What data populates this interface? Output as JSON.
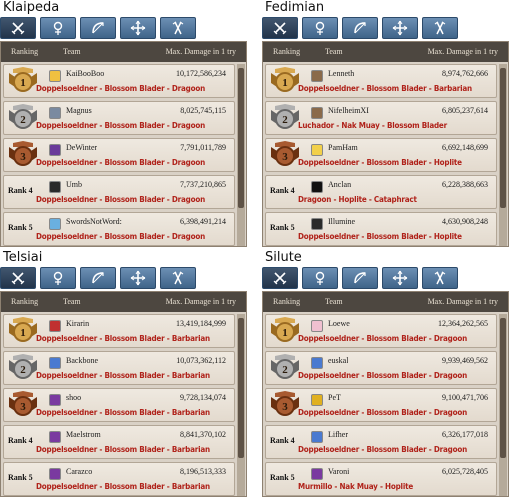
{
  "header": {
    "ranking": "Ranking",
    "team": "Team",
    "damage": "Max. Damage in 1 try"
  },
  "tabs": [
    "swords-icon",
    "spirit-icon",
    "bow-icon",
    "cross-icon",
    "scout-icon"
  ],
  "colors": {
    "accent_tab": "#4a6a8e",
    "build_text": "#b0221a",
    "gold": "#c8963c",
    "silver": "#8c8c8c",
    "bronze": "#8a4a2a"
  },
  "servers": [
    {
      "name": "Klaipeda",
      "rows": [
        {
          "rank": "1",
          "team": "KaiBooBoo",
          "damage": "10,172,586,234",
          "build": "Doppelsoeldner - Blossom Blader - Dragoon",
          "avatar": "sunglasses-icon"
        },
        {
          "rank": "2",
          "team": "Magnus",
          "damage": "8,025,745,115",
          "build": "Doppelsoeldner - Blossom Blader - Dragoon",
          "avatar": "helmet-icon"
        },
        {
          "rank": "3",
          "team": "DeWinter",
          "damage": "7,791,011,789",
          "build": "Doppelsoeldner - Blossom Blader - Dragoon",
          "avatar": "purple-crest-icon"
        },
        {
          "rank": "Rank 4",
          "team": "Umb",
          "damage": "7,737,210,865",
          "build": "Doppelsoeldner - Blossom Blader - Dragoon",
          "avatar": "dark-icon"
        },
        {
          "rank": "Rank 5",
          "team": "SwordsNotWord:",
          "damage": "6,398,491,214",
          "build": "Doppelsoeldner - Blossom Blader - Dragoon",
          "avatar": "blue-icon"
        }
      ]
    },
    {
      "name": "Fedimian",
      "rows": [
        {
          "rank": "1",
          "team": "Lenneth",
          "damage": "8,974,762,666",
          "build": "Doppelsoeldner - Blossom Blader - Barbarian",
          "avatar": "portrait-icon"
        },
        {
          "rank": "2",
          "team": "NifelheimXI",
          "damage": "6,805,237,614",
          "build": "Luchador - Nak Muay - Blossom Blader",
          "avatar": "portrait-icon"
        },
        {
          "rank": "3",
          "team": "PamHam",
          "damage": "6,692,148,699",
          "build": "Doppelsoeldner - Blossom Blader - Hoplite",
          "avatar": "chick-icon"
        },
        {
          "rank": "Rank 4",
          "team": "Anclan",
          "damage": "6,228,388,663",
          "build": "Dragoon - Hoplite - Cataphract",
          "avatar": "moon-icon"
        },
        {
          "rank": "Rank 5",
          "team": "Illumine",
          "damage": "4,630,908,248",
          "build": "Doppelsoeldner - Blossom Blader - Hoplite",
          "avatar": "dark-icon"
        }
      ]
    },
    {
      "name": "Telsiai",
      "rows": [
        {
          "rank": "1",
          "team": "Kirarin",
          "damage": "13,419,184,999",
          "build": "Doppelsoeldner - Blossom Blader - Barbarian",
          "avatar": "red-creature-icon"
        },
        {
          "rank": "2",
          "team": "Backbone",
          "damage": "10,073,362,112",
          "build": "Doppelsoeldner - Blossom Blader - Barbarian",
          "avatar": "blue-creature-icon"
        },
        {
          "rank": "3",
          "team": "shoo",
          "damage": "9,728,134,074",
          "build": "Doppelsoeldner - Blossom Blader - Barbarian",
          "avatar": "purple-creature-icon"
        },
        {
          "rank": "Rank 4",
          "team": "Maelstrom",
          "damage": "8,841,370,102",
          "build": "Doppelsoeldner - Blossom Blader - Barbarian",
          "avatar": "purple-creature-icon"
        },
        {
          "rank": "Rank 5",
          "team": "Carazco",
          "damage": "8,196,513,333",
          "build": "Doppelsoeldner - Blossom Blader - Barbarian",
          "avatar": "purple-creature-icon"
        }
      ]
    },
    {
      "name": "Silute",
      "rows": [
        {
          "rank": "1",
          "team": "Loewe",
          "damage": "12,364,262,565",
          "build": "Doppelsoeldner - Blossom Blader - Dragoon",
          "avatar": "pink-icon"
        },
        {
          "rank": "2",
          "team": "euskal",
          "damage": "9,939,469,562",
          "build": "Doppelsoeldner - Blossom Blader - Dragoon",
          "avatar": "blue-creature-icon"
        },
        {
          "rank": "3",
          "team": "PeT",
          "damage": "9,100,471,706",
          "build": "Doppelsoeldner - Blossom Blader - Dragoon",
          "avatar": "yellow-p-icon"
        },
        {
          "rank": "Rank 4",
          "team": "Lifher",
          "damage": "6,326,177,018",
          "build": "Doppelsoeldner - Blossom Blader - Dragoon",
          "avatar": "blue-creature-icon"
        },
        {
          "rank": "Rank 5",
          "team": "Varoni",
          "damage": "6,025,728,405",
          "build": "Murmillo - Nak Muay - Hoplite",
          "avatar": "purple-creature-icon"
        }
      ]
    }
  ]
}
